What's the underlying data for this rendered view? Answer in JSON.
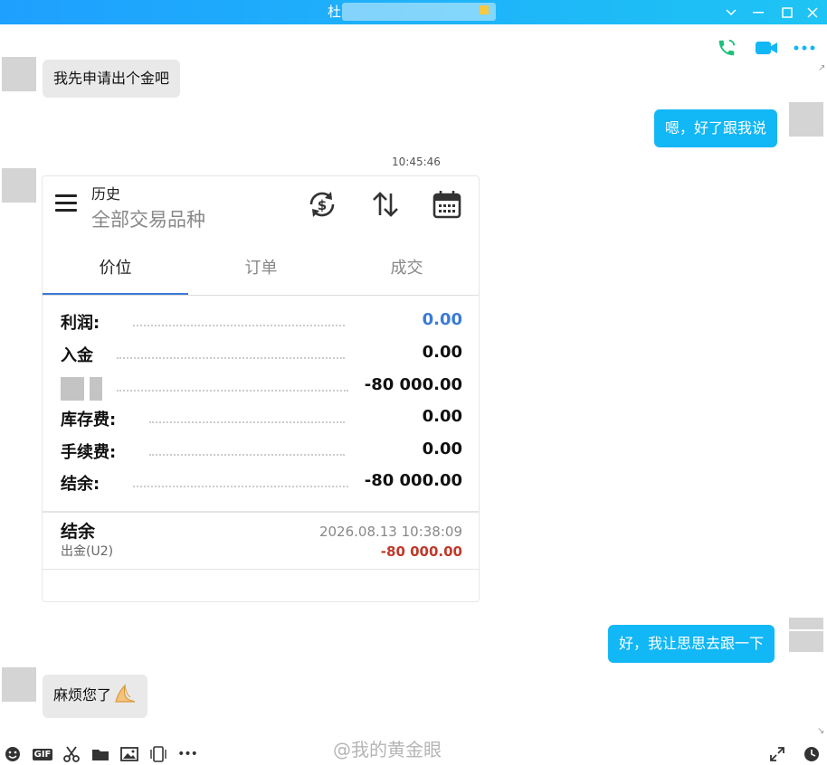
{
  "window": {
    "title": "杜",
    "minimize_label": "﹀",
    "restore_label": "—",
    "maximize_label": "□",
    "close_label": "✕"
  },
  "colors": {
    "accent": "#12b7f5",
    "titlebar": "#1ea0ff",
    "link_blue": "#3a7bd5",
    "negative_red": "#c0392b"
  },
  "header_actions": [
    {
      "icon": "phone-icon"
    },
    {
      "icon": "video-icon"
    },
    {
      "icon": "more-icon"
    }
  ],
  "messages": [
    {
      "side": "left",
      "text": "我先申请出个金吧"
    },
    {
      "side": "right",
      "text": "嗯，好了跟我说"
    },
    {
      "side": "right",
      "text": "好，我让思思去跟一下"
    },
    {
      "side": "left",
      "text": "麻烦您了"
    }
  ],
  "timestamp": "10:45:46",
  "card": {
    "title_small": "历史",
    "title_large": "全部交易品种",
    "tabs": [
      "价位",
      "订单",
      "成交"
    ],
    "active_tab": 0,
    "rows": [
      {
        "label": "利润:",
        "value": "0.00"
      },
      {
        "label": "入金",
        "value": "0.00"
      },
      {
        "label": "",
        "value": "-80 000.00"
      },
      {
        "label": "库存费:",
        "value": "0.00"
      },
      {
        "label": "手续费:",
        "value": "0.00"
      },
      {
        "label": "结余:",
        "value": "-80 000.00"
      }
    ],
    "balance": {
      "title": "结余",
      "subtitle": "出金(U2)",
      "datetime": "2026.08.13 10:38:09",
      "amount": "-80 000.00"
    }
  },
  "toolbar": {
    "left_icons": [
      "emoji-icon",
      "gif-icon",
      "scissors-icon",
      "folder-icon",
      "image-icon",
      "shake-icon",
      "more-icon"
    ],
    "gif_label": "GIF",
    "more_label": "•••",
    "right_icons": [
      "expand-icon",
      "history-clock-icon"
    ]
  },
  "watermark": "@我的黄金眼"
}
